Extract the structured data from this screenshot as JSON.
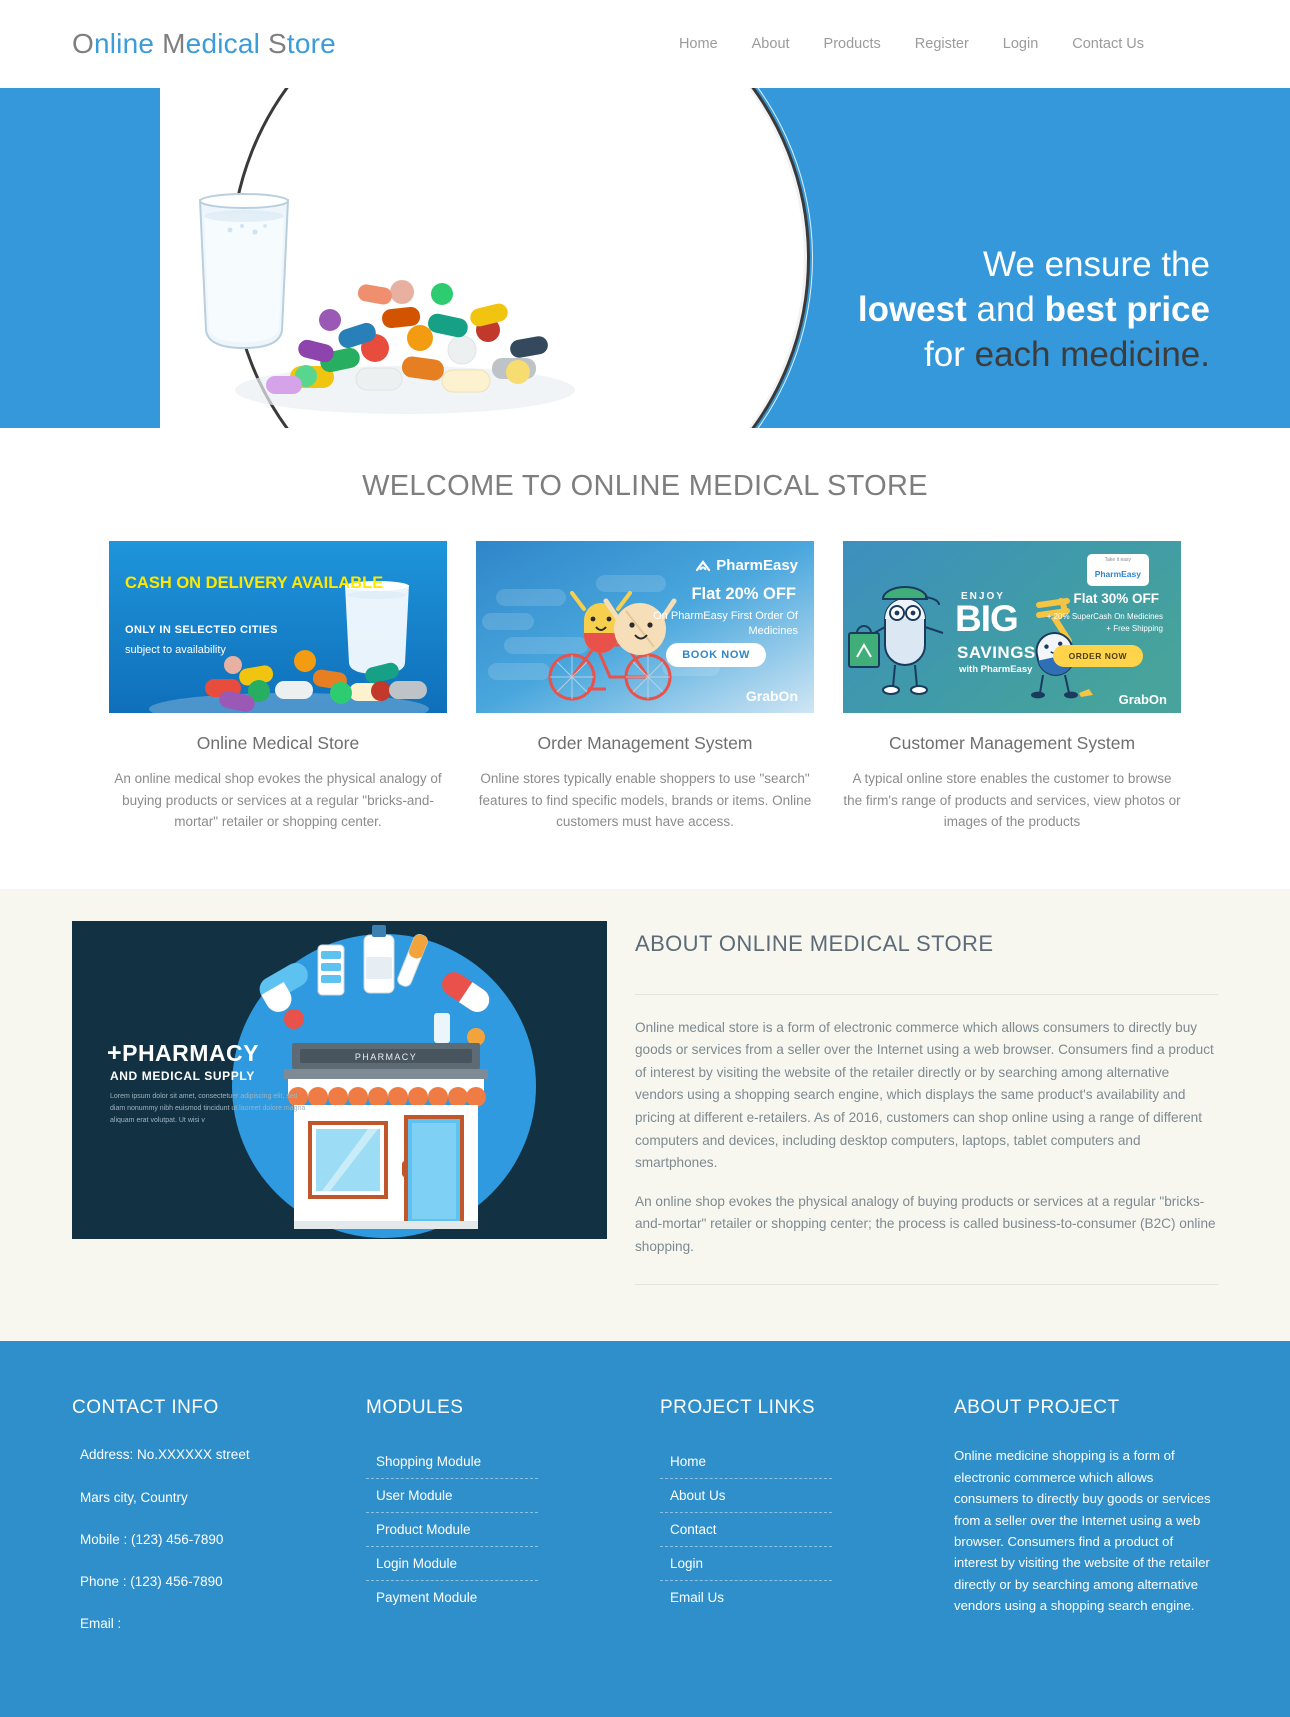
{
  "header": {
    "brand": {
      "word1_cap": "O",
      "word1_rest": "nline",
      "word2_cap": "M",
      "word2_rest": "edical",
      "word3_cap": "S",
      "word3_rest": "tore"
    },
    "nav": [
      {
        "label": "Home"
      },
      {
        "label": "About"
      },
      {
        "label": "Products"
      },
      {
        "label": "Register"
      },
      {
        "label": "Login"
      },
      {
        "label": "Contact Us"
      }
    ]
  },
  "hero": {
    "line1": "We ensure the",
    "line2_bold1": "lowest",
    "line2_mid": " and ",
    "line2_bold2": "best price",
    "line3_white": "for ",
    "line3_dark": "each medicine.",
    "background_color": "#3498db"
  },
  "welcome": {
    "heading": "WELCOME TO ONLINE MEDICAL STORE",
    "cards": [
      {
        "title": "Online Medical Store",
        "text": "An online medical shop evokes the physical analogy of buying products or services at a regular \"bricks-and-mortar\" retailer or shopping center.",
        "banner": {
          "headline": "CASH ON DELIVERY AVAILABLE",
          "subline": "ONLY IN SELECTED CITIES",
          "note": "subject to availability",
          "headline_color": "#ffe800",
          "bg_color": "#1b8ed6"
        }
      },
      {
        "title": "Order Management System",
        "text": "Online stores typically enable shoppers to use \"search\" features to find specific models, brands or items. Online customers must have access.",
        "banner": {
          "brand": "PharmEasy",
          "offer": "Flat 20% OFF",
          "detail": "On PharmEasy First Order Of Medicines",
          "cta": "BOOK NOW",
          "partner": "GrabOn"
        }
      },
      {
        "title": "Customer Management System",
        "text": "A typical online store enables the customer to browse the firm's range of products and services, view photos or images of the products",
        "banner": {
          "logo_tiny": "Take it easy",
          "logo_name": "PharmEasy",
          "enjoy": "ENJOY",
          "big": "BIG",
          "savings": "SAVINGS",
          "with": "with PharmEasy",
          "offer": "Flat 30% OFF",
          "detail1": "+ 20% SuperCash On Medicines",
          "detail2": "+ Free Shipping",
          "cta": "ORDER NOW",
          "partner": "GrabOn"
        }
      }
    ]
  },
  "about": {
    "image": {
      "title_plus": "+",
      "title": "PHARMACY",
      "subtitle": "AND MEDICAL SUPPLY",
      "lorem": "Lorem ipsum dolor sit amet, consectetuer adipiscing elit, sed diam nonummy nibh euismod tincidunt ut laoreet dolore magna aliquam erat volutpat. Ut wisi v",
      "sign": "PHARMACY",
      "bg_color": "#123244"
    },
    "heading": "ABOUT ONLINE MEDICAL STORE",
    "paragraph1": "Online medical store is a form of electronic commerce which allows consumers to directly buy goods or services from a seller over the Internet using a web browser. Consumers find a product of interest by visiting the website of the retailer directly or by searching among alternative vendors using a shopping search engine, which displays the same product's availability and pricing at different e-retailers. As of 2016, customers can shop online using a range of different computers and devices, including desktop computers, laptops, tablet computers and smartphones.",
    "paragraph2": "An online shop evokes the physical analogy of buying products or services at a regular \"bricks-and-mortar\" retailer or shopping center; the process is called business-to-consumer (B2C) online shopping."
  },
  "footer": {
    "background_color": "#2e8fcb",
    "contact": {
      "heading": "CONTACT INFO",
      "lines": [
        "Address: No.XXXXXX street",
        "Mars city, Country",
        "Mobile : (123) 456-7890",
        "Phone : (123) 456-7890",
        "Email :"
      ]
    },
    "modules": {
      "heading": "MODULES",
      "items": [
        {
          "label": "Shopping Module"
        },
        {
          "label": "User Module"
        },
        {
          "label": "Product Module"
        },
        {
          "label": "Login Module"
        },
        {
          "label": "Payment Module"
        }
      ]
    },
    "links": {
      "heading": "PROJECT LINKS",
      "items": [
        {
          "label": "Home"
        },
        {
          "label": "About Us"
        },
        {
          "label": "Contact"
        },
        {
          "label": "Login"
        },
        {
          "label": "Email Us"
        }
      ]
    },
    "about_project": {
      "heading": "ABOUT PROJECT",
      "text": "Online medicine shopping is a form of electronic commerce which allows consumers to directly buy goods or services from a seller over the Internet using a web browser. Consumers find a product of interest by visiting the website of the retailer directly or by searching among alternative vendors using a shopping search engine."
    }
  }
}
